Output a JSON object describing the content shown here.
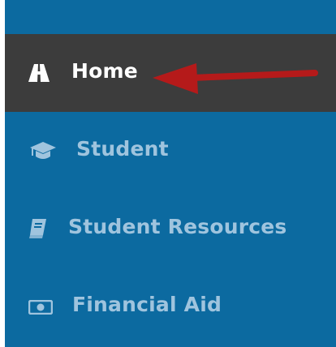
{
  "nav": {
    "items": [
      {
        "label": "Home",
        "icon": "road-icon",
        "active": true
      },
      {
        "label": "Student",
        "icon": "graduation-cap-icon",
        "active": false
      },
      {
        "label": "Student Resources",
        "icon": "book-icon",
        "active": false
      },
      {
        "label": "Financial Aid",
        "icon": "money-bill-icon",
        "active": false
      }
    ]
  },
  "colors": {
    "nav_bg": "#0c6aa0",
    "active_bg": "#3c3c3c",
    "active_text": "#ffffff",
    "inactive_text": "#9fc4de",
    "annotation_arrow": "#b51a1a"
  }
}
